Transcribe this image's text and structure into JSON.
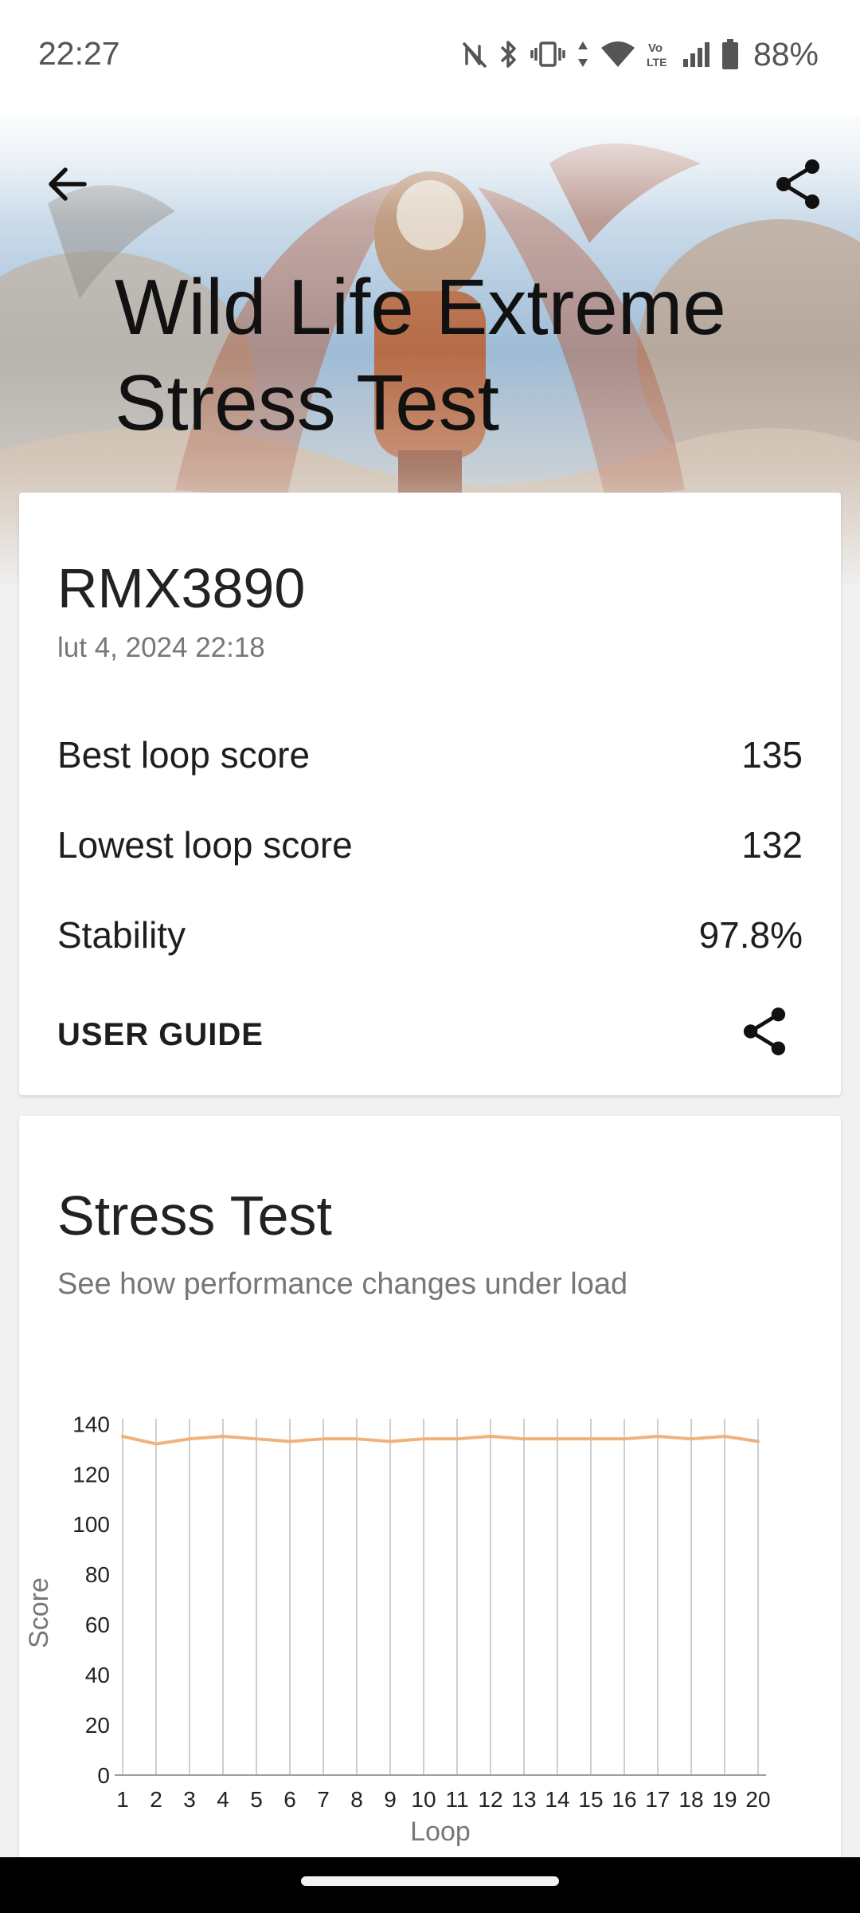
{
  "status_bar": {
    "time": "22:27",
    "battery": "88%",
    "icons": [
      "nfc-off-icon",
      "bluetooth-icon",
      "vibrate-icon",
      "data-arrows-icon",
      "wifi-icon",
      "volte-icon",
      "signal-icon",
      "battery-icon"
    ]
  },
  "header": {
    "title": "Wild Life Extreme Stress Test",
    "back_icon": "arrow-back-icon",
    "share_icon": "share-icon"
  },
  "summary": {
    "device": "RMX3890",
    "date": "lut 4, 2024 22:18",
    "stats": [
      {
        "label": "Best loop score",
        "value": "135"
      },
      {
        "label": "Lowest loop score",
        "value": "132"
      },
      {
        "label": "Stability",
        "value": "97.8%"
      }
    ],
    "user_guide_label": "USER GUIDE"
  },
  "stress_test": {
    "title": "Stress Test",
    "subtitle": "See how performance changes under load"
  },
  "chart_data": {
    "type": "line",
    "xlabel": "Loop",
    "ylabel": "Score",
    "x": [
      1,
      2,
      3,
      4,
      5,
      6,
      7,
      8,
      9,
      10,
      11,
      12,
      13,
      14,
      15,
      16,
      17,
      18,
      19,
      20
    ],
    "series": [
      {
        "values": [
          135,
          132,
          134,
          135,
          134,
          133,
          134,
          134,
          133,
          134,
          134,
          135,
          134,
          134,
          134,
          134,
          135,
          134,
          135,
          133
        ]
      }
    ],
    "yticks": [
      0,
      20,
      40,
      60,
      80,
      100,
      120,
      140
    ],
    "ylim": [
      0,
      142
    ],
    "xlim": [
      1,
      20
    ],
    "grid": "vertical",
    "line_color": "#f0b27a"
  }
}
